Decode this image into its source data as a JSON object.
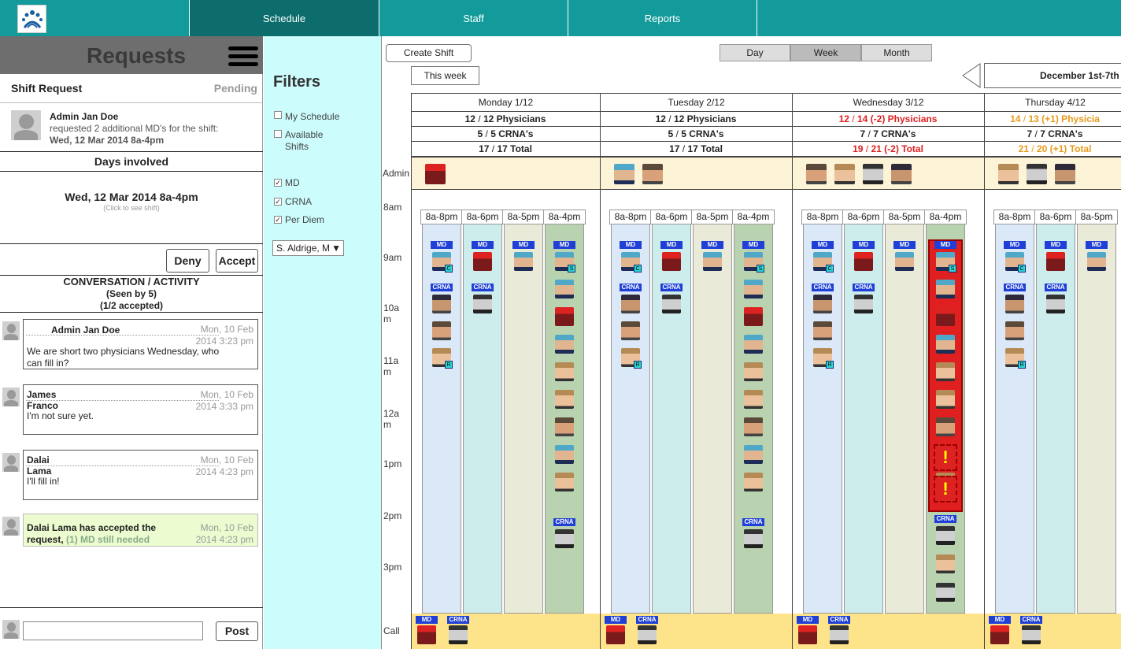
{
  "nav": {
    "tabs": [
      "Schedule",
      "Staff",
      "Reports"
    ]
  },
  "left": {
    "title": "Requests",
    "request_type": "Shift Request",
    "status": "Pending",
    "requester": "Admin Jan Doe",
    "request_text": "requested 2 additional MD's for the shift:",
    "request_date": "Wed, 12 Mar 2014 8a-4pm",
    "days_involved_label": "Days involved",
    "day_value": "Wed, 12 Mar 2014 8a-4pm",
    "day_hint": "(Click to see shift)",
    "deny": "Deny",
    "accept": "Accept",
    "conv_title": "CONVERSATION / ACTIVITY",
    "conv_seen": "(Seen by 5)",
    "conv_accept_num": "1",
    "conv_accept_rest": "/2 accepted)",
    "messages": [
      {
        "name": "Admin Jan Doe",
        "date1": "Mon, 10 Feb",
        "date2": "2014 3:23 pm",
        "body": "We are short two physicians Wednesday, who can fill in?"
      },
      {
        "name": "James",
        "name2": "Franco",
        "date1": "Mon, 10 Feb",
        "date2": "2014 3:33 pm",
        "body": "I'm not sure yet."
      },
      {
        "name": "Dalai",
        "name2": "Lama",
        "date1": "Mon, 10 Feb",
        "date2": "2014 4:23 pm",
        "body": "I'll fill in!"
      },
      {
        "body1": "Dalai Lama has accepted the",
        "body2a": "request,",
        "body2b": "(1) MD still needed",
        "date1": "Mon, 10 Feb",
        "date2": "2014 4:23 pm"
      }
    ],
    "post": "Post"
  },
  "filters": {
    "title": "Filters",
    "items": [
      "My Schedule",
      "Available",
      "Shifts",
      "MD",
      "CRNA",
      "Per Diem"
    ],
    "select": "S. Aldrige, M"
  },
  "toolbar": {
    "create": "Create Shift",
    "this_week": "This week",
    "views": [
      "Day",
      "Week",
      "Month"
    ],
    "date_range": "December 1st-7th"
  },
  "schedule": {
    "days": [
      "Monday 1/12",
      "Tuesday 2/12",
      "Wednesday 3/12",
      "Thursday 4/12"
    ],
    "phys": [
      [
        "12",
        "12",
        " Physicians"
      ],
      [
        "12",
        "12",
        " Physicians"
      ],
      [
        "12",
        "14",
        " (-2) Physicians"
      ],
      [
        "14",
        "13",
        " (+1) Physicia"
      ]
    ],
    "crna": [
      [
        "5",
        "5",
        " CRNA's"
      ],
      [
        "5",
        "5",
        " CRNA's"
      ],
      [
        "7",
        "7",
        " CRNA's"
      ],
      [
        "7",
        "7",
        " CRNA's"
      ]
    ],
    "total": [
      [
        "17",
        "17",
        " Total"
      ],
      [
        "17",
        "17",
        " Total"
      ],
      [
        "19",
        "21",
        " (-2) Total"
      ],
      [
        "21",
        "20",
        " (+1) Total"
      ]
    ],
    "row_colors": {
      "warn": "#e02020",
      "over": "#e89a1a"
    },
    "times": [
      "8am",
      "9am",
      "10a",
      "m",
      "11a",
      "m",
      "12a",
      "m",
      "1pm",
      "2pm",
      "3pm"
    ],
    "admin_label": "Admin",
    "call_label": "Call",
    "shift_labels": [
      "8a-8pm",
      "8a-6pm",
      "8a-5pm",
      "8a-4pm"
    ],
    "tags": {
      "md": "MD",
      "crna": "CRNA"
    },
    "badges": {
      "c": "C",
      "r": "R",
      "s": "S"
    },
    "warn": "!"
  }
}
